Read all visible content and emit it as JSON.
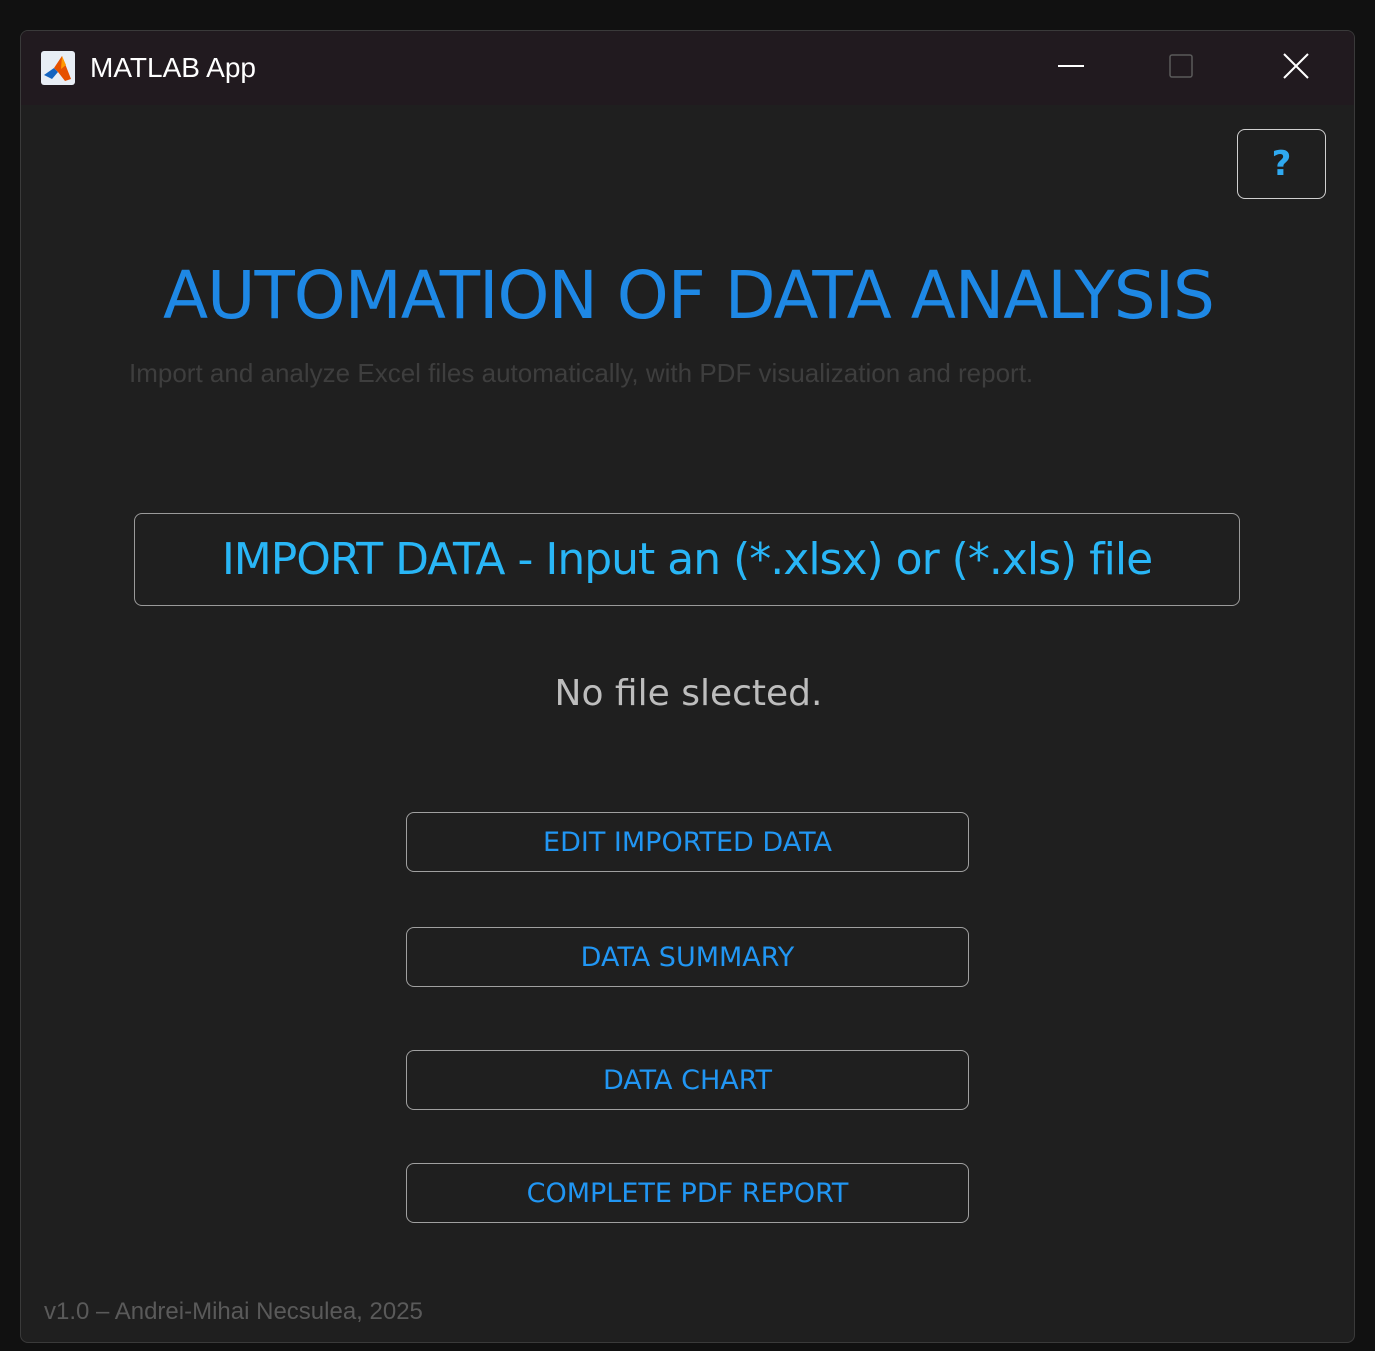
{
  "window": {
    "title": "MATLAB App",
    "controls": {
      "minimize": "minimize",
      "maximize": "maximize",
      "close": "close"
    }
  },
  "help_button": {
    "label": "?"
  },
  "header": {
    "title": "AUTOMATION OF DATA ANALYSIS",
    "subtitle": "Import and analyze Excel files automatically, with PDF visualization and report."
  },
  "import": {
    "label": "IMPORT DATA - Input an (*.xlsx) or (*.xls) file"
  },
  "status": {
    "text": "No file slected."
  },
  "actions": {
    "edit_label": "EDIT IMPORTED DATA",
    "summary_label": "DATA SUMMARY",
    "chart_label": "DATA CHART",
    "pdf_label": "COMPLETE PDF REPORT"
  },
  "footer": {
    "text": "v1.0 – Andrei-Mihai Necsulea, 2025"
  },
  "colors": {
    "accent": "#1e88e5",
    "import_text": "#29b6f6",
    "background": "#1f1f1f",
    "titlebar": "#211a1f"
  },
  "icons": {
    "app": "matlab-logo-icon",
    "minimize": "minimize-icon",
    "maximize": "maximize-icon",
    "close": "close-icon"
  }
}
